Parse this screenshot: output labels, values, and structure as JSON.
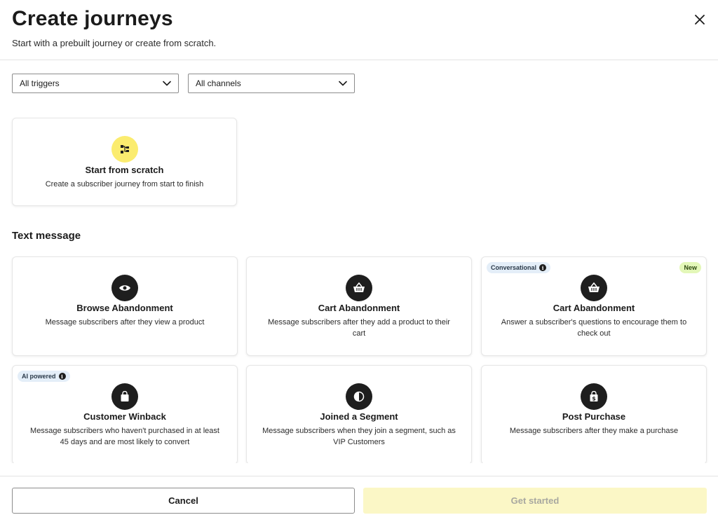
{
  "header": {
    "title": "Create journeys",
    "subtitle": "Start with a prebuilt journey or create from scratch.",
    "close_icon": "close-icon"
  },
  "filters": {
    "triggers": {
      "value": "All triggers",
      "icon": "chevron-down-icon"
    },
    "channels": {
      "value": "All channels",
      "icon": "chevron-down-icon"
    }
  },
  "scratch_card": {
    "title": "Start from scratch",
    "description": "Create a subscriber journey from start to finish",
    "icon": "flow-icon",
    "icon_bg": "#fbec6f"
  },
  "section": {
    "title": "Text message"
  },
  "cards": [
    {
      "title": "Browse Abandonment",
      "description": "Message subscribers after they view a product",
      "icon": "eye-icon"
    },
    {
      "title": "Cart Abandonment",
      "description": "Message subscribers after they add a product to their cart",
      "icon": "basket-icon"
    },
    {
      "title": "Cart Abandonment",
      "description": "Answer a subscriber's questions to encourage them to check out",
      "icon": "basket-icon",
      "badge_left": "Conversational",
      "badge_right": "New"
    },
    {
      "title": "Customer Winback",
      "description": "Message subscribers who haven't purchased in at least 45 days and are most likely to convert",
      "icon": "bag-icon",
      "badge_left": "AI powered"
    },
    {
      "title": "Joined a Segment",
      "description": "Message subscribers when they join a segment, such as VIP Customers",
      "icon": "half-circle-icon"
    },
    {
      "title": "Post Purchase",
      "description": "Message subscribers after they make a purchase",
      "icon": "dollar-bag-icon"
    }
  ],
  "footer": {
    "cancel_label": "Cancel",
    "start_label": "Get started"
  },
  "colors": {
    "accent_yellow": "#fbec6f",
    "disabled_button": "#fbf7c6",
    "badge_blue": "#e4eef8",
    "badge_green": "#e3f7b8"
  }
}
